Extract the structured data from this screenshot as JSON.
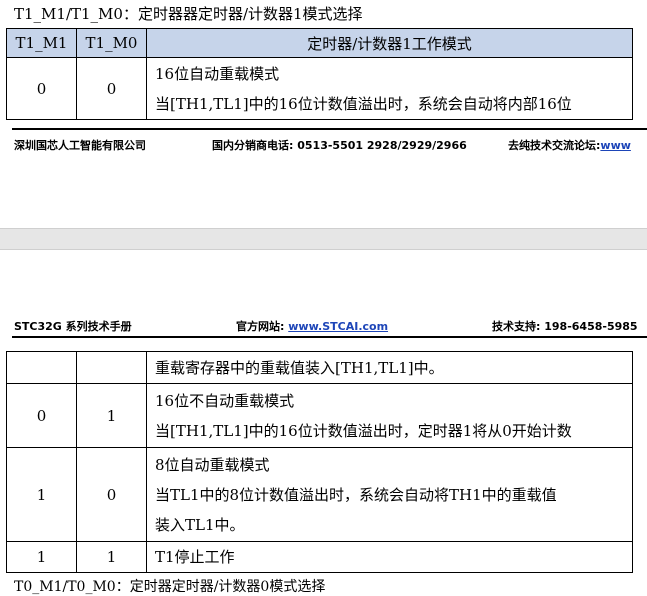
{
  "section_title": "T1_M1/T1_M0：定时器器定时器/计数器1模式选择",
  "table_headers": [
    "T1_M1",
    "T1_M0",
    "定时器/计数器1工作模式"
  ],
  "rows_top": [
    {
      "m1": "0",
      "m0": "0",
      "lines": [
        "16位自动重载模式",
        "当[TH1,TL1]中的16位计数值溢出时，系统会自动将内部16位"
      ]
    }
  ],
  "footer": {
    "company": "深圳国芯人工智能有限公司",
    "phone_label": "国内分销商电话:",
    "phone": "0513-5501 2928/2929/2966",
    "forum_label": "去纯技术交流论坛:",
    "forum_link": "www"
  },
  "header": {
    "manual": "STC32G 系列技术手册",
    "site_label": "官方网站:",
    "site_link": "www.STCAI.com",
    "support_label": "技术支持:",
    "support_phone": "198-6458-5985"
  },
  "rows_bottom": [
    {
      "m1": "",
      "m0": "",
      "lines": [
        "重载寄存器中的重载值装入[TH1,TL1]中。"
      ]
    },
    {
      "m1": "0",
      "m0": "1",
      "lines": [
        "16位不自动重载模式",
        "当[TH1,TL1]中的16位计数值溢出时，定时器1将从0开始计数"
      ]
    },
    {
      "m1": "1",
      "m0": "0",
      "lines": [
        "8位自动重载模式",
        "当TL1中的8位计数值溢出时，系统会自动将TH1中的重载值",
        "装入TL1中。"
      ]
    },
    {
      "m1": "1",
      "m0": "1",
      "lines": [
        "T1停止工作"
      ]
    }
  ],
  "next_section_title": "T0_M1/T0_M0：定时器定时器/计数器0模式选择"
}
